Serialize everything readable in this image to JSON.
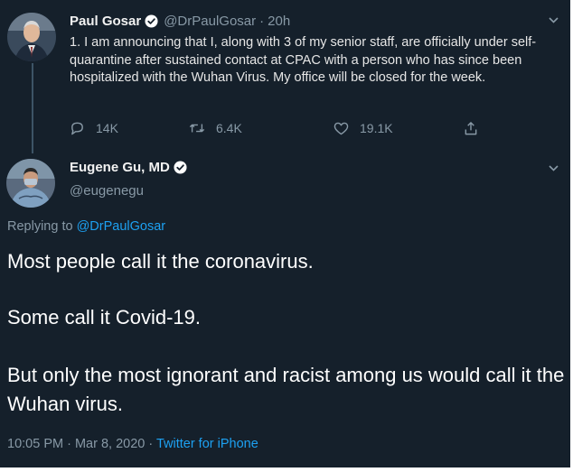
{
  "tweet1": {
    "name": "Paul Gosar",
    "handle": "@DrPaulGosar",
    "separator": "·",
    "time": "20h",
    "text": "1. I am announcing that I, along with 3 of my senior staff, are officially under self-quarantine after sustained contact at CPAC with a person who has since been hospitalized with the Wuhan Virus.  My office will be closed for the week.",
    "replies": "14K",
    "retweets": "6.4K",
    "likes": "19.1K"
  },
  "tweet2": {
    "name": "Eugene Gu, MD",
    "handle": "@eugenegu",
    "replying_prefix": "Replying to",
    "replying_to": "@DrPaulGosar",
    "paragraphs": [
      "Most people call it the coronavirus.",
      "Some call it Covid-19.",
      "But only the most ignorant and racist among us would call it the Wuhan virus."
    ],
    "timestamp": "10:05 PM · Mar 8, 2020 · ",
    "source": "Twitter for iPhone"
  },
  "icons": {
    "verified": "verified-badge-icon",
    "reply": "reply-icon",
    "retweet": "retweet-icon",
    "like": "heart-icon",
    "share": "share-icon",
    "more": "chevron-down-icon"
  },
  "colors": {
    "background": "#15202b",
    "accent": "#1da1f2",
    "muted": "#8899a6",
    "text": "#ffffff"
  }
}
